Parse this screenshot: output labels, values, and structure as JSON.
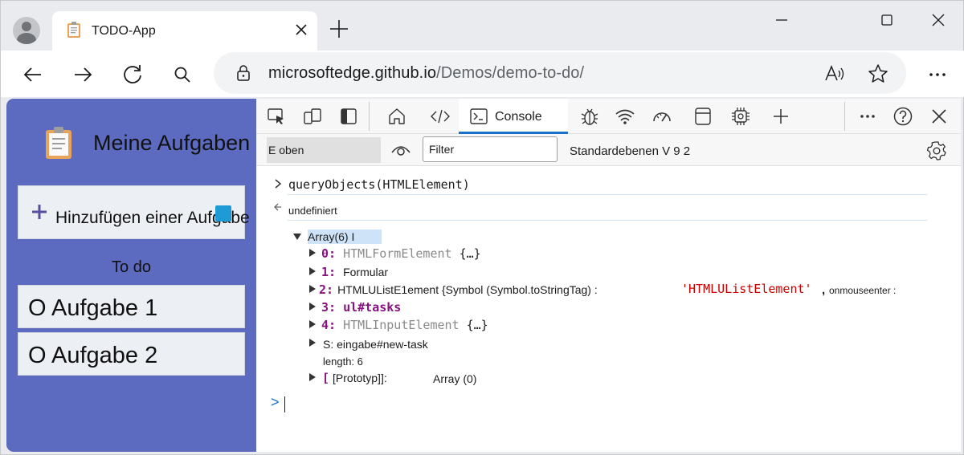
{
  "browser": {
    "tab_title": "TODO-App",
    "url_host": "microsoftedge.github.io",
    "url_path": "/Demos/demo-to-do/"
  },
  "app": {
    "title": "Meine Aufgaben",
    "add_task_label": "Hinzufügen einer Aufgabe",
    "section_title": "To do",
    "tasks": [
      "O Aufgabe 1",
      "O Aufgabe 2"
    ]
  },
  "devtools": {
    "console_tab_label": "Console",
    "context_label": "E oben",
    "filter_placeholder": "Filter",
    "levels_label": "Standardebenen V 9 2",
    "console": {
      "input_command": "queryObjects(HTMLElement)",
      "return_value": "undefiniert",
      "array_header": "Array(6) I",
      "entries": [
        {
          "index": "0:",
          "value": "HTMLFormElement",
          "suffix": "{…}"
        },
        {
          "index": "1:",
          "value": "Formular"
        },
        {
          "index": "2:",
          "value": "HTMLUListE1ement {Symbol (Symbol.toStringTag) :",
          "string": "'HTMLUListElement'",
          "tail": "onmouseenter :"
        },
        {
          "index": "3:",
          "value": "ul#tasks"
        },
        {
          "index": "4:",
          "value": "HTMLInputElement",
          "suffix": "{…}"
        },
        {
          "index": "S:",
          "value": "eingabe#new-task"
        }
      ],
      "length_label": "length: 6",
      "prototype_label": "[Prototyp]]:",
      "prototype_bracket": "[",
      "prototype_value": "Array (0)",
      "prompt": ">"
    }
  },
  "colors": {
    "app_background": "#5c6bc0",
    "accent_blue": "#1a6fc8",
    "console_keyword_purple": "#881280",
    "console_string_red": "#c80000"
  }
}
